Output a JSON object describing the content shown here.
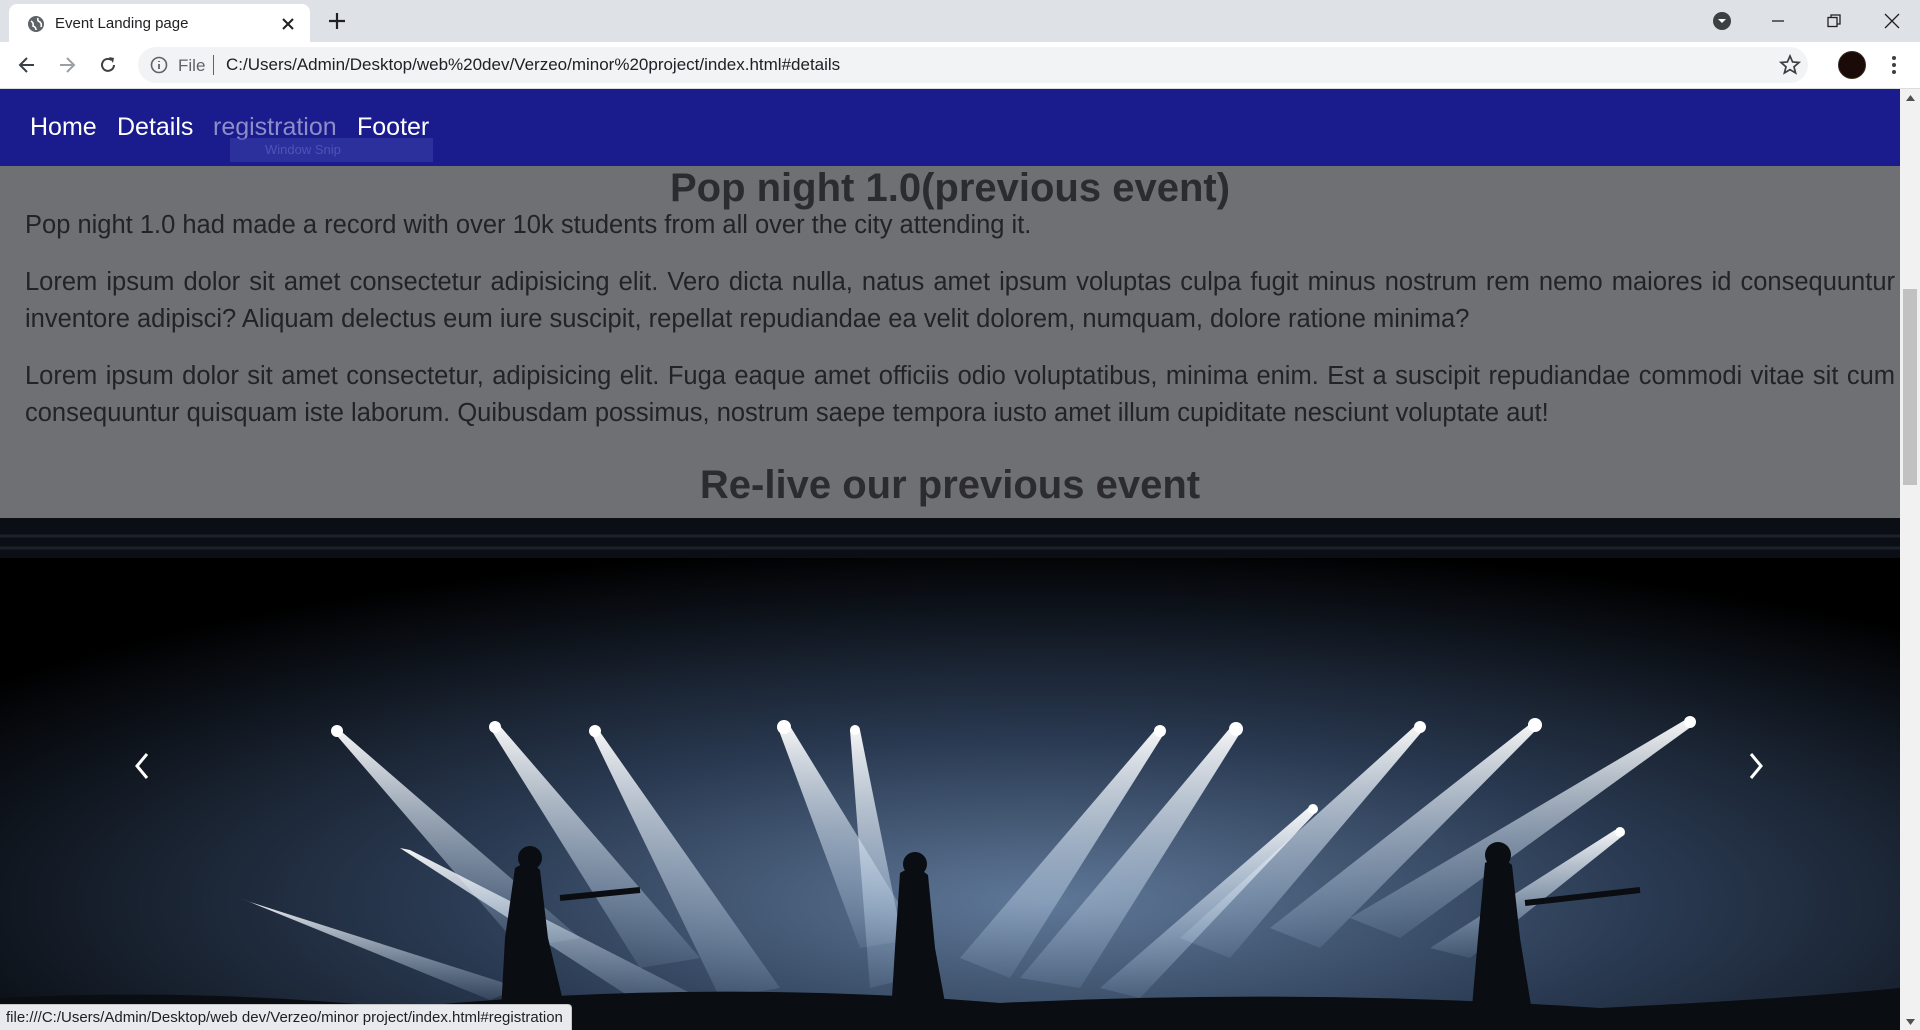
{
  "browser": {
    "tab_title": "Event Landing page",
    "omnibox_scheme": "File",
    "omnibox_url": "C:/Users/Admin/Desktop/web%20dev/Verzeo/minor%20project/index.html#details",
    "status_url": "file:///C:/Users/Admin/Desktop/web dev/Verzeo/minor project/index.html#registration"
  },
  "nav": {
    "items": [
      {
        "label": "Home"
      },
      {
        "label": "Details"
      },
      {
        "label": "registration"
      },
      {
        "label": "Footer"
      }
    ],
    "hover_tooltip": "Window Snip"
  },
  "details": {
    "heading": "Pop night 1.0(previous event)",
    "intro": "Pop night 1.0 had made a record with over 10k students from all over the city attending it.",
    "paragraph_1": "Lorem ipsum dolor sit amet consectetur adipisicing elit. Vero dicta nulla, natus amet ipsum voluptas culpa fugit minus nostrum rem nemo maiores id consequuntur inventore adipisci? Aliquam delectus eum iure suscipit, repellat repudiandae ea velit dolorem, numquam, dolore ratione minima?",
    "paragraph_2": "Lorem ipsum dolor sit amet consectetur, adipisicing elit. Fuga eaque amet officiis odio voluptatibus, minima enim. Est a suscipit repudiandae commodi vitae sit cum consequuntur quisquam iste laborum. Quibusdam possimus, nostrum saepe tempora iusto amet illum cupiditate nesciunt voluptate aut!",
    "relive_heading": "Re-live our previous event"
  },
  "colors": {
    "navbar": "#1a1b8c",
    "details_bg": "#6f7074",
    "active_link": "#8d8ec8"
  },
  "icons": {
    "carousel_prev": "chevron-left-icon",
    "carousel_next": "chevron-right-icon"
  }
}
